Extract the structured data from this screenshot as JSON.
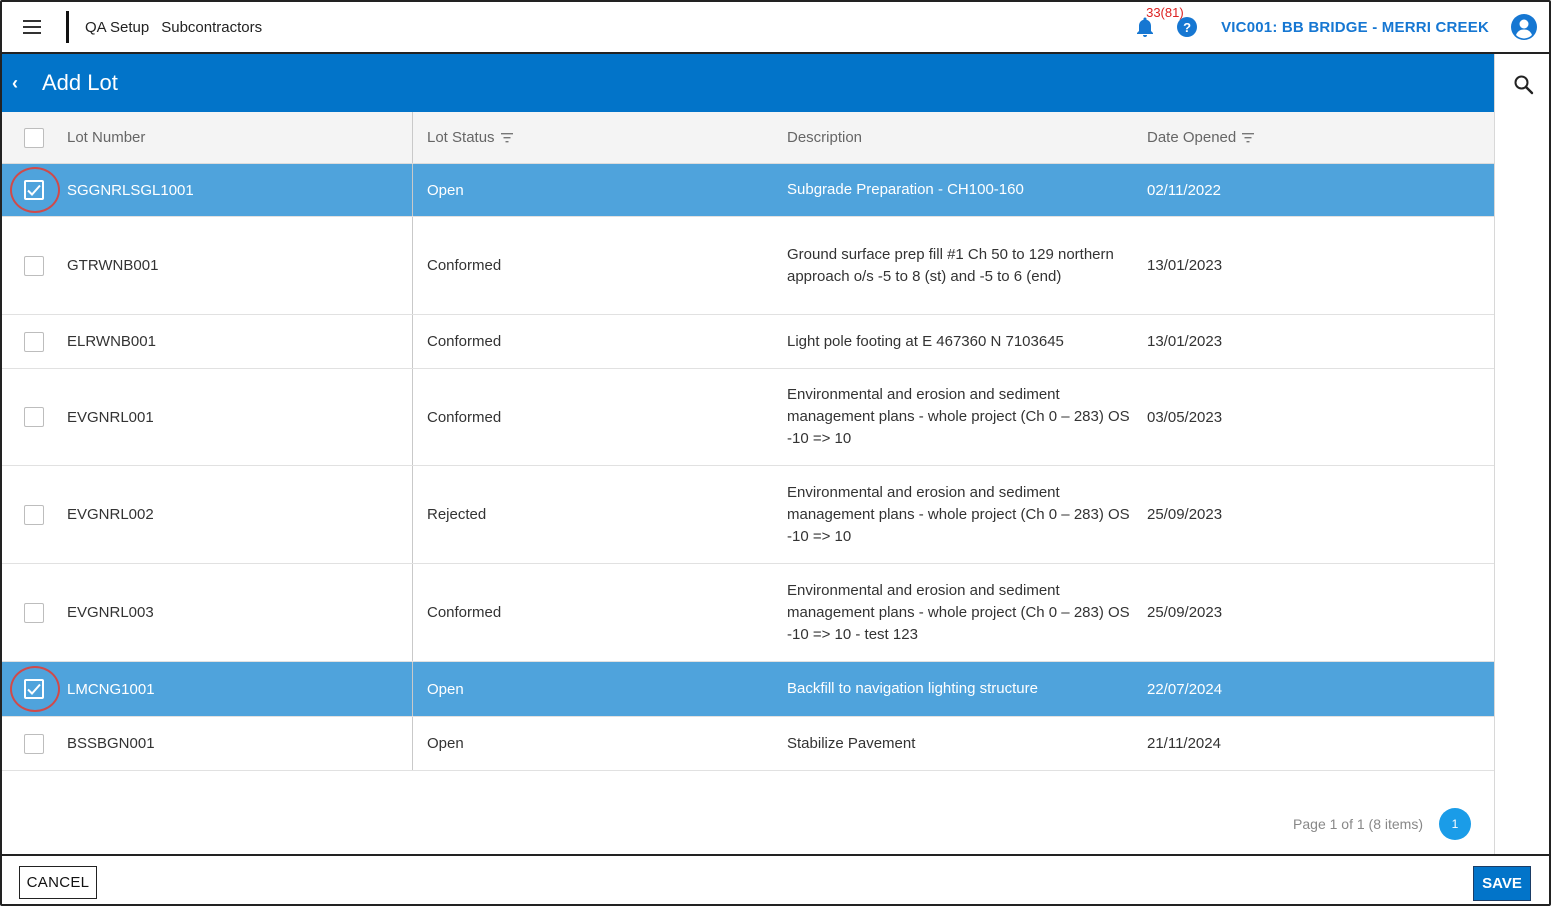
{
  "topbar": {
    "breadcrumb": [
      "QA Setup",
      "Subcontractors"
    ],
    "notifications": "33(81)",
    "project": "VIC001: BB BRIDGE - MERRI CREEK",
    "help_icon": "?"
  },
  "header": {
    "title": "Add Lot",
    "back_icon": "‹"
  },
  "table": {
    "columns": [
      "Lot Number",
      "Lot Status",
      "Description",
      "Date Opened"
    ],
    "rows": [
      {
        "lot": "SGGNRLSGL1001",
        "status": "Open",
        "description": "Subgrade Preparation - CH100-160",
        "date": "02/11/2022",
        "selected": true
      },
      {
        "lot": "GTRWNB001",
        "status": "Conformed",
        "description": "Ground surface prep fill #1 Ch 50 to 129 northern approach o/s -5 to 8 (st) and -5 to 6 (end)",
        "date": "13/01/2023",
        "selected": false
      },
      {
        "lot": "ELRWNB001",
        "status": "Conformed",
        "description": "Light pole footing at E 467360 N 7103645",
        "date": "13/01/2023",
        "selected": false
      },
      {
        "lot": "EVGNRL001",
        "status": "Conformed",
        "description": "Environmental and erosion and sediment management plans - whole project (Ch 0 – 283) OS -10 => 10",
        "date": "03/05/2023",
        "selected": false
      },
      {
        "lot": "EVGNRL002",
        "status": "Rejected",
        "description": "Environmental and erosion and sediment management plans - whole project (Ch 0 – 283) OS -10 => 10",
        "date": "25/09/2023",
        "selected": false
      },
      {
        "lot": "EVGNRL003",
        "status": "Conformed",
        "description": "Environmental and erosion and sediment management plans - whole project (Ch 0 – 283) OS -10 => 10 - test 123",
        "date": "25/09/2023",
        "selected": false
      },
      {
        "lot": "LMCNG1001",
        "status": "Open",
        "description": "Backfill to navigation lighting structure",
        "date": "22/07/2024",
        "selected": true
      },
      {
        "lot": "BSSBGN001",
        "status": "Open",
        "description": "Stabilize Pavement",
        "date": "21/11/2024",
        "selected": false
      }
    ]
  },
  "pager": {
    "info": "Page 1 of 1 (8 items)",
    "current": "1"
  },
  "footer": {
    "cancel_label": "CANCEL",
    "save_label": "SAVE"
  },
  "colors": {
    "accent": "#0274c9",
    "selected_row": "#4fa3dc",
    "highlight_ring": "#d04a4a",
    "notification": "#dd2222"
  }
}
